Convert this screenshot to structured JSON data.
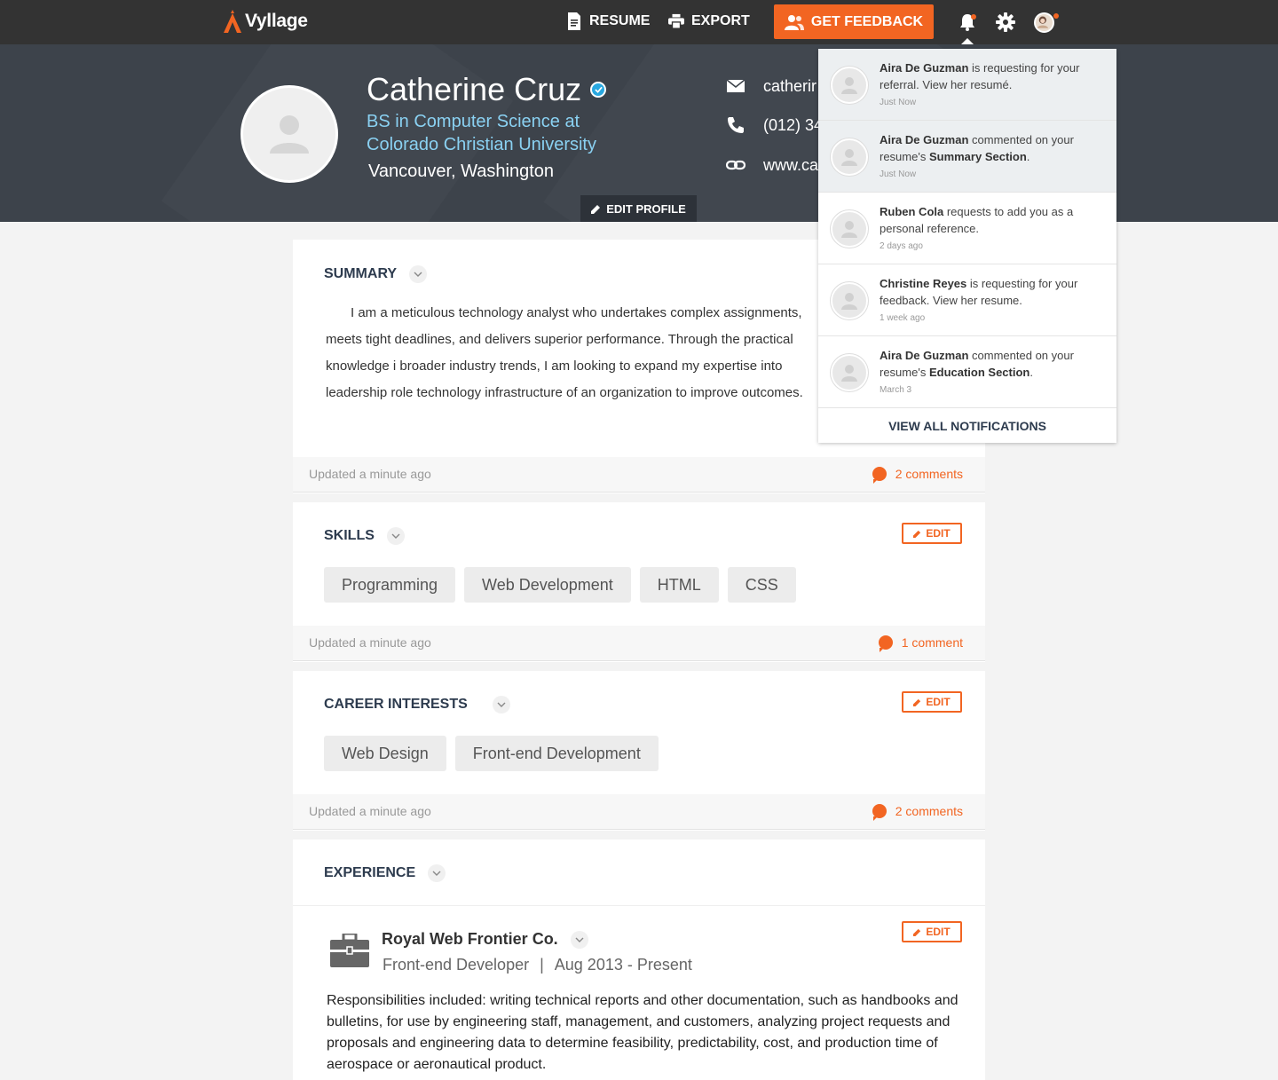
{
  "nav": {
    "logo_text": "Vyllage",
    "resume_label": "RESUME",
    "export_label": "EXPORT",
    "feedback_label": "GET FEEDBACK",
    "accent_color": "#f26522"
  },
  "profile": {
    "name": "Catherine Cruz",
    "degree": "BS in Computer Science at Colorado Christian University",
    "location": "Vancouver, Washington",
    "email": "catherir",
    "phone": "(012) 34",
    "website": "www.ca",
    "edit_label": "EDIT PROFILE"
  },
  "summary": {
    "title": "SUMMARY",
    "text": "I am a meticulous technology analyst who undertakes complex assignments, meets tight deadlines, and delivers superior performance. Through the practical knowledge i broader industry trends, I am looking to expand my expertise into leadership role technology infrastructure of an organization to improve outcomes.",
    "updated": "Updated a minute ago",
    "comments": "2 comments"
  },
  "skills": {
    "title": "SKILLS",
    "edit_label": "EDIT",
    "tags": [
      "Programming",
      "Web Development",
      "HTML",
      "CSS"
    ],
    "updated": "Updated a minute ago",
    "comments": "1 comment"
  },
  "career": {
    "title": "CAREER INTERESTS",
    "edit_label": "EDIT",
    "tags": [
      "Web Design",
      "Front-end Development"
    ],
    "updated": "Updated a minute ago",
    "comments": "2 comments"
  },
  "experience": {
    "title": "EXPERIENCE",
    "edit_label": "EDIT",
    "company": "Royal Web Frontier Co.",
    "role": "Front-end Developer",
    "separator": "|",
    "dates": "Aug 2013 - Present",
    "description": "Responsibilities included: writing technical reports and other documentation, such as handbooks and bulletins, for use by engineering staff, management, and customers, analyzing project requests and proposals and engineering data to determine feasibility, predictability, cost, and production time of aerospace or aeronautical product."
  },
  "notifications": {
    "items": [
      {
        "name": "Aira De Guzman",
        "text": " is requesting for your referral. View her resumé.",
        "time": "Just Now",
        "unread": true
      },
      {
        "name": "Aira De Guzman",
        "text": " commented on your resume's ",
        "bold2": "Summary Section",
        "text2": ".",
        "time": "Just Now",
        "unread": true
      },
      {
        "name": "Ruben Cola",
        "text": " requests to add you as a personal reference.",
        "time": "2 days ago",
        "unread": false
      },
      {
        "name": "Christine Reyes",
        "text": " is requesting for your feedback. View her resume.",
        "time": "1 week ago",
        "unread": false
      },
      {
        "name": "Aira De Guzman",
        "text": " commented on your resume's ",
        "bold2": "Education Section",
        "text2": ".",
        "time": "March 3",
        "unread": false
      }
    ],
    "view_all": "VIEW ALL NOTIFICATIONS"
  }
}
